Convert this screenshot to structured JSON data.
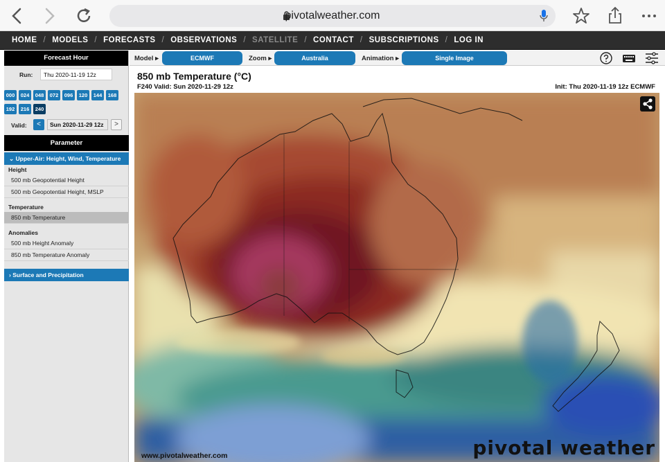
{
  "browser": {
    "url": "pivotalweather.com"
  },
  "nav": {
    "items": [
      {
        "label": "HOME"
      },
      {
        "label": "MODELS"
      },
      {
        "label": "FORECASTS"
      },
      {
        "label": "OBSERVATIONS"
      },
      {
        "label": "SATELLITE"
      },
      {
        "label": "CONTACT"
      },
      {
        "label": "SUBSCRIPTIONS"
      },
      {
        "label": "LOG IN"
      }
    ]
  },
  "sidebar": {
    "forecast_hour_heading": "Forecast Hour",
    "run_label": "Run:",
    "run_value": "Thu 2020-11-19 12z",
    "hours": [
      "000",
      "024",
      "048",
      "072",
      "096",
      "120",
      "144",
      "168",
      "192",
      "216",
      "240"
    ],
    "active_hour": "240",
    "valid_label": "Valid:",
    "valid_prev": "<",
    "valid_value": "Sun 2020-11-29 12z",
    "valid_next": ">",
    "parameter_heading": "Parameter",
    "category_open": "Upper-Air: Height, Wind, Temperature",
    "groups": [
      {
        "label": "Height",
        "items": [
          "500 mb Geopotential Height",
          "500 mb Geopotential Height, MSLP"
        ]
      },
      {
        "label": "Temperature",
        "items": [
          "850 mb Temperature"
        ]
      },
      {
        "label": "Anomalies",
        "items": [
          "500 mb Height Anomaly",
          "850 mb Temperature Anomaly"
        ]
      }
    ],
    "selected_item": "850 mb Temperature",
    "category_closed": "Surface and Precipitation"
  },
  "toolbar": {
    "model_label": "Model ▸",
    "model_value": "ECMWF",
    "zoom_label": "Zoom ▸",
    "zoom_value": "Australia",
    "animation_label": "Animation ▸",
    "animation_value": "Single Image"
  },
  "map": {
    "title": "850 mb Temperature (°C)",
    "subtitle": "F240 Valid: Sun 2020-11-29 12z",
    "init": "Init: Thu 2020-11-19 12z ECMWF",
    "watermark_url": "www.pivotalweather.com",
    "watermark_logo": "pivotal weather"
  },
  "colors": {
    "accent_blue": "#1c79b6",
    "nav_dark": "#2d2d2d"
  }
}
